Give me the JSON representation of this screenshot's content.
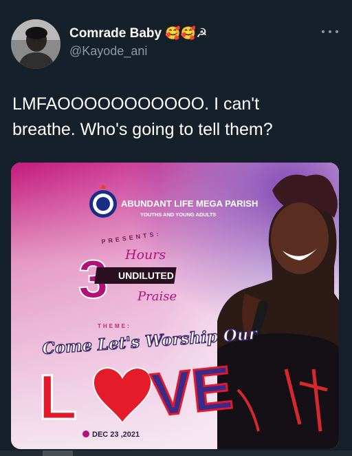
{
  "tweet": {
    "display_name": "Comrade Baby",
    "name_emojis": "🥰🥰☭",
    "handle": "@Kayode_ani",
    "text_line1": "LMFAOOOOOOOOOOO. I can't",
    "text_line2": "breathe. Who's going to tell them?"
  },
  "flyer": {
    "parish": "ABUNDANT LIFE MEGA PARISH",
    "group": "YOUTHS AND YOUNG ADULTS",
    "presents": "PRESENTS:",
    "number": "3",
    "hours": "Hours",
    "undiluted": "UNDILUTED",
    "praise": "Praise",
    "theme_label": "THEME:",
    "theme": "Come Let's Worship Our",
    "love_l": "L",
    "love_ve": "VE",
    "date": "DEC 23 ,2021"
  },
  "colors": {
    "background": "#15202b",
    "secondary_text": "#8b98a5",
    "flyer_magenta": "#c2187a",
    "love_red": "#e01a2b",
    "love_blue": "#3a2a8a"
  }
}
